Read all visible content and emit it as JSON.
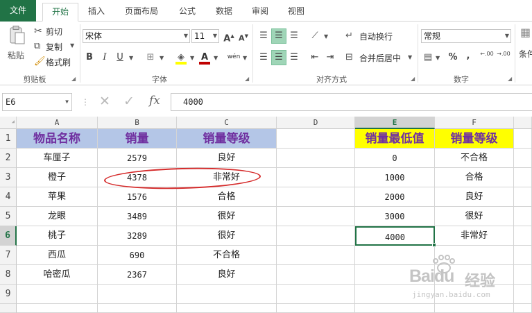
{
  "tabs": [
    "文件",
    "开始",
    "插入",
    "页面布局",
    "公式",
    "数据",
    "审阅",
    "视图"
  ],
  "clipboard": {
    "paste": "粘贴",
    "cut": "剪切",
    "copy": "复制",
    "format_painter": "格式刷",
    "group": "剪贴板"
  },
  "font": {
    "name": "宋体",
    "size": "11",
    "grow": "A",
    "shrink": "A",
    "bold": "B",
    "italic": "I",
    "underline": "U",
    "phonetic": "wén",
    "group": "字体"
  },
  "alignment": {
    "wrap": "自动换行",
    "merge": "合并后居中",
    "group": "对齐方式"
  },
  "number": {
    "format": "常规",
    "group": "数字",
    "percent": "%",
    "comma": ",",
    "inc_decimal": ".00",
    "dec_decimal": ".00"
  },
  "styles": {
    "cond_format": "条件"
  },
  "formula_bar": {
    "name_box": "E6",
    "formula": "4000",
    "fx": "fx"
  },
  "colors": {
    "accent": "#217346",
    "header_blue": "#b4c6e7",
    "header_yellow": "#ffff00",
    "header_text": "#7030a0",
    "circle": "#d52b2b"
  },
  "grid": {
    "columns": [
      "A",
      "B",
      "C",
      "D",
      "E",
      "F"
    ],
    "rows": [
      "1",
      "2",
      "3",
      "4",
      "5",
      "6",
      "7",
      "8",
      "9"
    ],
    "table1_headers": [
      "物品名称",
      "销量",
      "销量等级"
    ],
    "table1_rows": [
      [
        "车厘子",
        "2579",
        "良好"
      ],
      [
        "橙子",
        "4378",
        "非常好"
      ],
      [
        "苹果",
        "1576",
        "合格"
      ],
      [
        "龙眼",
        "3489",
        "很好"
      ],
      [
        "桃子",
        "3289",
        "很好"
      ],
      [
        "西瓜",
        "690",
        "不合格"
      ],
      [
        "哈密瓜",
        "2367",
        "良好"
      ]
    ],
    "table2_headers": [
      "销量最低值",
      "销量等级"
    ],
    "table2_rows": [
      [
        "0",
        "不合格"
      ],
      [
        "1000",
        "合格"
      ],
      [
        "2000",
        "良好"
      ],
      [
        "3000",
        "很好"
      ],
      [
        "4000",
        "非常好"
      ]
    ]
  },
  "watermark": {
    "brand": "Baidu",
    "brand_cn": "经验",
    "url": "jingyan.baidu.com"
  }
}
